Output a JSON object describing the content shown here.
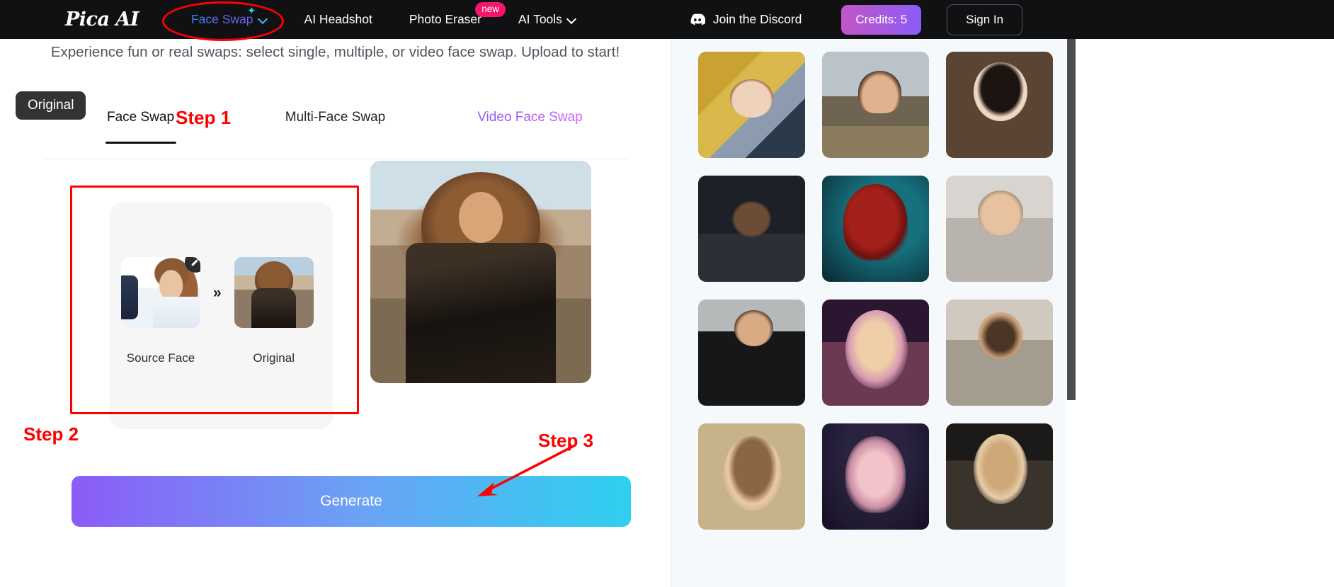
{
  "header": {
    "logo": "Pica AI",
    "nav": [
      {
        "label": "Face Swap",
        "icon": "sparkle-icon",
        "chevron": true,
        "gradient": true
      },
      {
        "label": "AI Headshot",
        "chevron": false,
        "gradient": false
      },
      {
        "label": "Photo Eraser",
        "badge": "new",
        "chevron": false,
        "gradient": false
      },
      {
        "label": "AI Tools",
        "chevron": true,
        "gradient": false
      }
    ],
    "discord_label": "Join the Discord",
    "discord_icon": "discord-icon",
    "credits_label": "Credits: 5",
    "credits_value": 5,
    "signin_label": "Sign In",
    "colors": {
      "bar_bg": "#111113",
      "credits_gradient_start": "#c256c8",
      "credits_gradient_end": "#8b5cf6",
      "badge_new": "#f5156c",
      "face_swap_gradient_start": "#3b82f6",
      "face_swap_gradient_end": "#7c5cf0"
    }
  },
  "main": {
    "subtitle": "Experience fun or real swaps: select single, multiple, or video face swap. Upload to start!",
    "tabs": [
      {
        "label": "Face Swap",
        "active": true
      },
      {
        "label": "Multi-Face Swap",
        "active": false
      },
      {
        "label": "Video Face Swap",
        "active": false,
        "gradient": true
      }
    ],
    "upload_card": {
      "source_label": "Source Face",
      "target_label": "Original",
      "separator": "»",
      "edit_icon": "pencil-icon"
    },
    "preview": {
      "badge": "Original"
    },
    "generate_label": "Generate",
    "generate_gradient": {
      "start": "#8b5cf6",
      "mid": "#6aa3f5",
      "end": "#2ed0ef"
    }
  },
  "annotations": {
    "color": "#ff0000",
    "step1": "Step 1",
    "step2": "Step 2",
    "step3": "Step 3"
  },
  "gallery": {
    "background": "#f6f9fc",
    "columns": 3,
    "items": [
      {
        "alt": "golden-klimt-style-portrait"
      },
      {
        "alt": "man-in-hat-highland-portrait"
      },
      {
        "alt": "snow-white-with-red-apple"
      },
      {
        "alt": "man-in-cap-with-car"
      },
      {
        "alt": "red-haired-woman-teal-background"
      },
      {
        "alt": "woman-in-white-futuristic-suit"
      },
      {
        "alt": "woman-in-black-blazer"
      },
      {
        "alt": "fairy-woman-with-flower-crown"
      },
      {
        "alt": "woman-in-cream-blazer"
      },
      {
        "alt": "vintage-pinup-woman-portrait"
      },
      {
        "alt": "woman-with-cat-ear-headphones"
      },
      {
        "alt": "woman-with-long-blonde-hair"
      }
    ]
  }
}
